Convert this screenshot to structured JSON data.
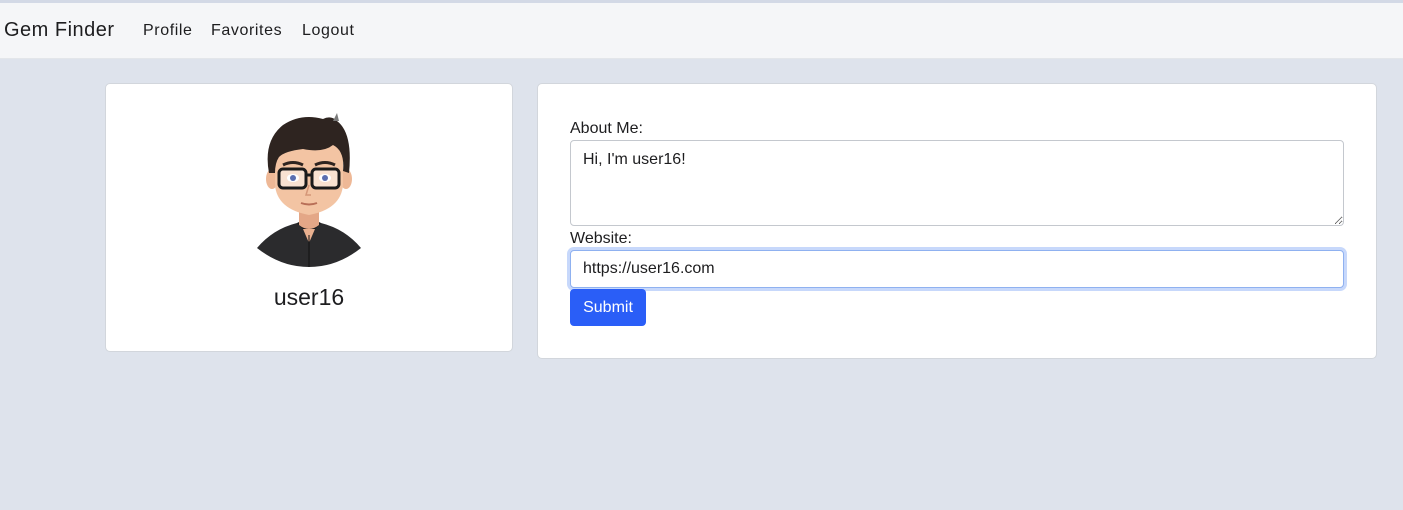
{
  "navbar": {
    "brand": "Gem Finder",
    "links": [
      {
        "label": "Profile"
      },
      {
        "label": "Favorites"
      },
      {
        "label": "Logout"
      }
    ]
  },
  "profile_card": {
    "avatar_icon": "cartoon-man-with-glasses-avatar",
    "username": "user16"
  },
  "form": {
    "about_label": "About Me:",
    "about_value": "Hi, I'm user16!",
    "website_label": "Website:",
    "website_value": "https://user16.com",
    "submit_label": "Submit"
  },
  "colors": {
    "page_background": "#dee3ec",
    "navbar_background": "#f5f6f8",
    "submit_button": "#2a5ef7",
    "focus_ring": "#c7d8fb"
  }
}
